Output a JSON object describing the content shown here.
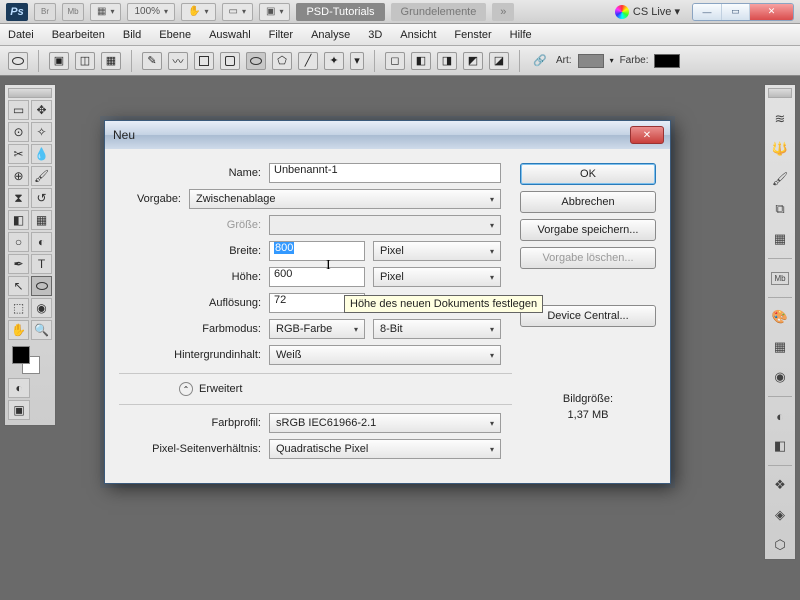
{
  "app": {
    "logo": "Ps",
    "zoom": "100%",
    "br": "Br",
    "mb": "Mb"
  },
  "tabs": {
    "tutorials": "PSD-Tutorials",
    "grund": "Grundelemente",
    "more": "»"
  },
  "cslive": {
    "label": "CS Live ▾"
  },
  "menu": {
    "datei": "Datei",
    "bearbeiten": "Bearbeiten",
    "bild": "Bild",
    "ebene": "Ebene",
    "auswahl": "Auswahl",
    "filter": "Filter",
    "analyse": "Analyse",
    "d3": "3D",
    "ansicht": "Ansicht",
    "fenster": "Fenster",
    "hilfe": "Hilfe"
  },
  "optbar": {
    "art": "Art:",
    "farbe": "Farbe:"
  },
  "dialog": {
    "title": "Neu",
    "name_lbl": "Name:",
    "name_val": "Unbenannt-1",
    "vorgabe_lbl": "Vorgabe:",
    "vorgabe_val": "Zwischenablage",
    "groesse_lbl": "Größe:",
    "breite_lbl": "Breite:",
    "breite_val": "800",
    "breite_unit": "Pixel",
    "hoehe_lbl": "Höhe:",
    "hoehe_val": "600",
    "hoehe_unit": "Pixel",
    "aufl_lbl": "Auflösung:",
    "aufl_val": "72",
    "farbmodus_lbl": "Farbmodus:",
    "farbmodus_val": "RGB-Farbe",
    "farbtiefe": "8-Bit",
    "hg_lbl": "Hintergrundinhalt:",
    "hg_val": "Weiß",
    "erweitert": "Erweitert",
    "farbprofil_lbl": "Farbprofil:",
    "farbprofil_val": "sRGB IEC61966-2.1",
    "psv_lbl": "Pixel-Seitenverhältnis:",
    "psv_val": "Quadratische Pixel",
    "ok": "OK",
    "cancel": "Abbrechen",
    "save": "Vorgabe speichern...",
    "del": "Vorgabe löschen...",
    "device": "Device Central...",
    "size_lbl": "Bildgröße:",
    "size_val": "1,37 MB"
  },
  "tooltip": "Höhe des neuen Dokuments festlegen"
}
